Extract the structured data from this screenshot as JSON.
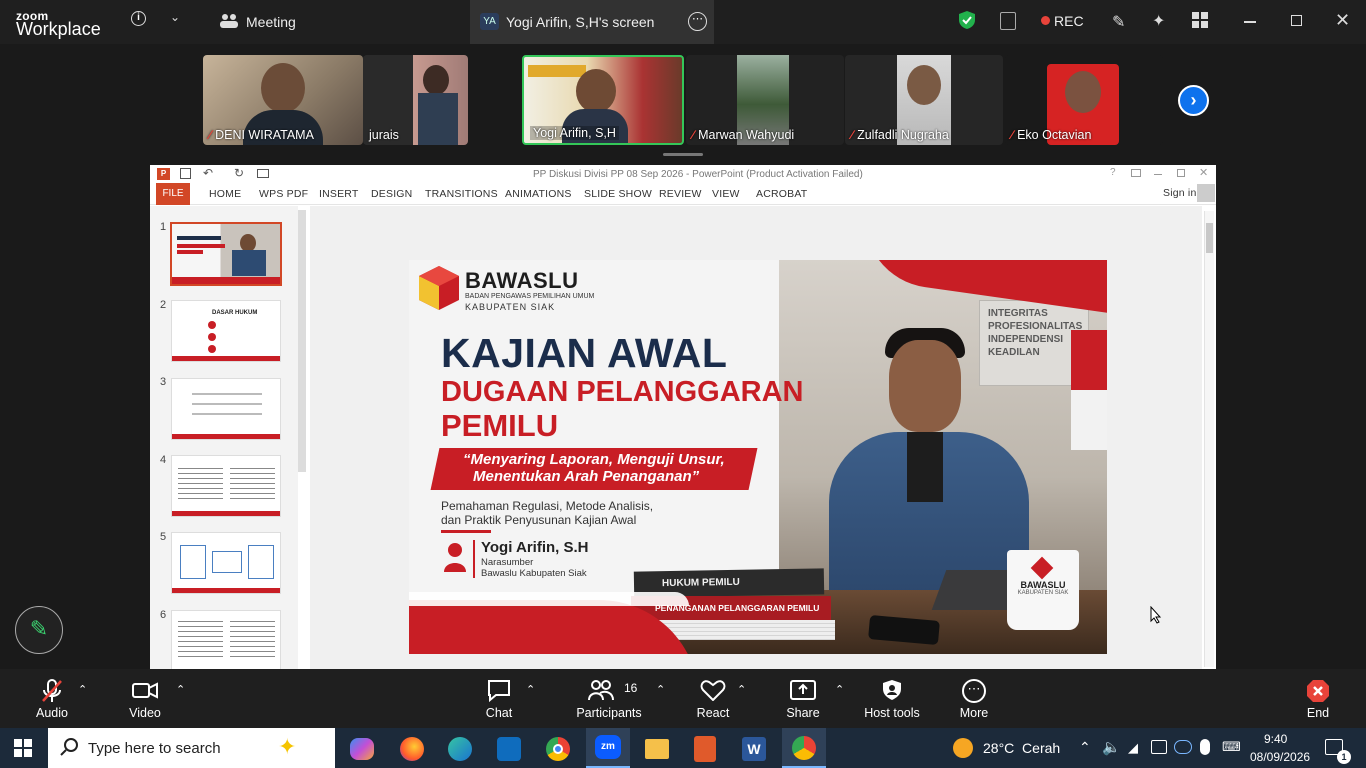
{
  "topbar": {
    "logo_small": "zoom",
    "logo_big": "Workplace",
    "meeting_label": "Meeting",
    "screen_badge": "YA",
    "screen_label": "Yogi Arifin, S,H's screen",
    "rec_label": "REC"
  },
  "participants_strip": [
    {
      "name": "DENI WIRATAMA",
      "muted": true
    },
    {
      "name": "jurais",
      "muted": false
    },
    {
      "name": "Yogi Arifin, S,H",
      "muted": false
    },
    {
      "name": "Marwan Wahyudi",
      "muted": true
    },
    {
      "name": "Zulfadli Nugraha",
      "muted": true
    },
    {
      "name": "Eko Octavian",
      "muted": true
    }
  ],
  "ppt": {
    "title": "PP Diskusi Divisi PP 08 Sep 2026 - PowerPoint (Product Activation Failed)",
    "sign_in": "Sign in",
    "tabs": [
      "FILE",
      "HOME",
      "WPS PDF",
      "INSERT",
      "DESIGN",
      "TRANSITIONS",
      "ANIMATIONS",
      "SLIDE SHOW",
      "REVIEW",
      "VIEW",
      "ACROBAT"
    ],
    "slide_numbers": [
      "1",
      "2",
      "3",
      "4",
      "5",
      "6"
    ],
    "thumb2_title": "DASAR HUKUM"
  },
  "slide": {
    "brand": "BAWASLU",
    "brand_sub1": "BADAN PENGAWAS PEMILIHAN UMUM",
    "brand_sub2": "KABUPATEN SIAK",
    "title1": "KAJIAN AWAL",
    "title2": "DUGAAN PELANGGARAN",
    "title3": "PEMILU",
    "quote1": "“Menyaring Laporan, Menguji Unsur,",
    "quote2": "Menentukan Arah Penanganan”",
    "desc1": "Pemahaman Regulasi, Metode Analisis,",
    "desc2": "dan Praktik Penyusunan Kajian Awal",
    "speaker_name": "Yogi Arifin, S.H",
    "speaker_role": "Narasumber",
    "speaker_org": "Bawaslu Kabupaten Siak",
    "wall_sign": [
      "INTEGRITAS",
      "PROFESIONALITAS",
      "INDEPENDENSI",
      "KEADILAN"
    ],
    "book1": "HUKUM PEMILU",
    "book2": "PENANGANAN PELANGGARAN PEMILU",
    "mug_brand": "BAWASLU",
    "mug_sub": "KABUPATEN SIAK"
  },
  "bottombar": {
    "audio": "Audio",
    "video": "Video",
    "chat": "Chat",
    "participants": "Participants",
    "participants_count": "16",
    "react": "React",
    "share": "Share",
    "host_tools": "Host tools",
    "more": "More",
    "end": "End"
  },
  "taskbar": {
    "search_placeholder": "Type here to search",
    "weather": "28°C  Cerah",
    "time": "9:40",
    "date": "08/09/2026",
    "notif_count": "1"
  }
}
